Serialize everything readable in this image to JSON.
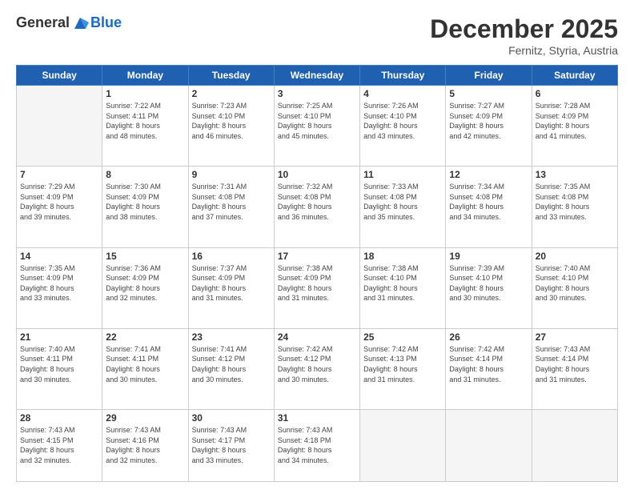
{
  "header": {
    "logo_line1": "General",
    "logo_line2": "Blue",
    "month": "December 2025",
    "location": "Fernitz, Styria, Austria"
  },
  "weekdays": [
    "Sunday",
    "Monday",
    "Tuesday",
    "Wednesday",
    "Thursday",
    "Friday",
    "Saturday"
  ],
  "weeks": [
    [
      {
        "day": "",
        "info": ""
      },
      {
        "day": "1",
        "info": "Sunrise: 7:22 AM\nSunset: 4:11 PM\nDaylight: 8 hours\nand 48 minutes."
      },
      {
        "day": "2",
        "info": "Sunrise: 7:23 AM\nSunset: 4:10 PM\nDaylight: 8 hours\nand 46 minutes."
      },
      {
        "day": "3",
        "info": "Sunrise: 7:25 AM\nSunset: 4:10 PM\nDaylight: 8 hours\nand 45 minutes."
      },
      {
        "day": "4",
        "info": "Sunrise: 7:26 AM\nSunset: 4:10 PM\nDaylight: 8 hours\nand 43 minutes."
      },
      {
        "day": "5",
        "info": "Sunrise: 7:27 AM\nSunset: 4:09 PM\nDaylight: 8 hours\nand 42 minutes."
      },
      {
        "day": "6",
        "info": "Sunrise: 7:28 AM\nSunset: 4:09 PM\nDaylight: 8 hours\nand 41 minutes."
      }
    ],
    [
      {
        "day": "7",
        "info": "Sunrise: 7:29 AM\nSunset: 4:09 PM\nDaylight: 8 hours\nand 39 minutes."
      },
      {
        "day": "8",
        "info": "Sunrise: 7:30 AM\nSunset: 4:09 PM\nDaylight: 8 hours\nand 38 minutes."
      },
      {
        "day": "9",
        "info": "Sunrise: 7:31 AM\nSunset: 4:08 PM\nDaylight: 8 hours\nand 37 minutes."
      },
      {
        "day": "10",
        "info": "Sunrise: 7:32 AM\nSunset: 4:08 PM\nDaylight: 8 hours\nand 36 minutes."
      },
      {
        "day": "11",
        "info": "Sunrise: 7:33 AM\nSunset: 4:08 PM\nDaylight: 8 hours\nand 35 minutes."
      },
      {
        "day": "12",
        "info": "Sunrise: 7:34 AM\nSunset: 4:08 PM\nDaylight: 8 hours\nand 34 minutes."
      },
      {
        "day": "13",
        "info": "Sunrise: 7:35 AM\nSunset: 4:08 PM\nDaylight: 8 hours\nand 33 minutes."
      }
    ],
    [
      {
        "day": "14",
        "info": "Sunrise: 7:35 AM\nSunset: 4:09 PM\nDaylight: 8 hours\nand 33 minutes."
      },
      {
        "day": "15",
        "info": "Sunrise: 7:36 AM\nSunset: 4:09 PM\nDaylight: 8 hours\nand 32 minutes."
      },
      {
        "day": "16",
        "info": "Sunrise: 7:37 AM\nSunset: 4:09 PM\nDaylight: 8 hours\nand 31 minutes."
      },
      {
        "day": "17",
        "info": "Sunrise: 7:38 AM\nSunset: 4:09 PM\nDaylight: 8 hours\nand 31 minutes."
      },
      {
        "day": "18",
        "info": "Sunrise: 7:38 AM\nSunset: 4:10 PM\nDaylight: 8 hours\nand 31 minutes."
      },
      {
        "day": "19",
        "info": "Sunrise: 7:39 AM\nSunset: 4:10 PM\nDaylight: 8 hours\nand 30 minutes."
      },
      {
        "day": "20",
        "info": "Sunrise: 7:40 AM\nSunset: 4:10 PM\nDaylight: 8 hours\nand 30 minutes."
      }
    ],
    [
      {
        "day": "21",
        "info": "Sunrise: 7:40 AM\nSunset: 4:11 PM\nDaylight: 8 hours\nand 30 minutes."
      },
      {
        "day": "22",
        "info": "Sunrise: 7:41 AM\nSunset: 4:11 PM\nDaylight: 8 hours\nand 30 minutes."
      },
      {
        "day": "23",
        "info": "Sunrise: 7:41 AM\nSunset: 4:12 PM\nDaylight: 8 hours\nand 30 minutes."
      },
      {
        "day": "24",
        "info": "Sunrise: 7:42 AM\nSunset: 4:12 PM\nDaylight: 8 hours\nand 30 minutes."
      },
      {
        "day": "25",
        "info": "Sunrise: 7:42 AM\nSunset: 4:13 PM\nDaylight: 8 hours\nand 31 minutes."
      },
      {
        "day": "26",
        "info": "Sunrise: 7:42 AM\nSunset: 4:14 PM\nDaylight: 8 hours\nand 31 minutes."
      },
      {
        "day": "27",
        "info": "Sunrise: 7:43 AM\nSunset: 4:14 PM\nDaylight: 8 hours\nand 31 minutes."
      }
    ],
    [
      {
        "day": "28",
        "info": "Sunrise: 7:43 AM\nSunset: 4:15 PM\nDaylight: 8 hours\nand 32 minutes."
      },
      {
        "day": "29",
        "info": "Sunrise: 7:43 AM\nSunset: 4:16 PM\nDaylight: 8 hours\nand 32 minutes."
      },
      {
        "day": "30",
        "info": "Sunrise: 7:43 AM\nSunset: 4:17 PM\nDaylight: 8 hours\nand 33 minutes."
      },
      {
        "day": "31",
        "info": "Sunrise: 7:43 AM\nSunset: 4:18 PM\nDaylight: 8 hours\nand 34 minutes."
      },
      {
        "day": "",
        "info": ""
      },
      {
        "day": "",
        "info": ""
      },
      {
        "day": "",
        "info": ""
      }
    ]
  ]
}
